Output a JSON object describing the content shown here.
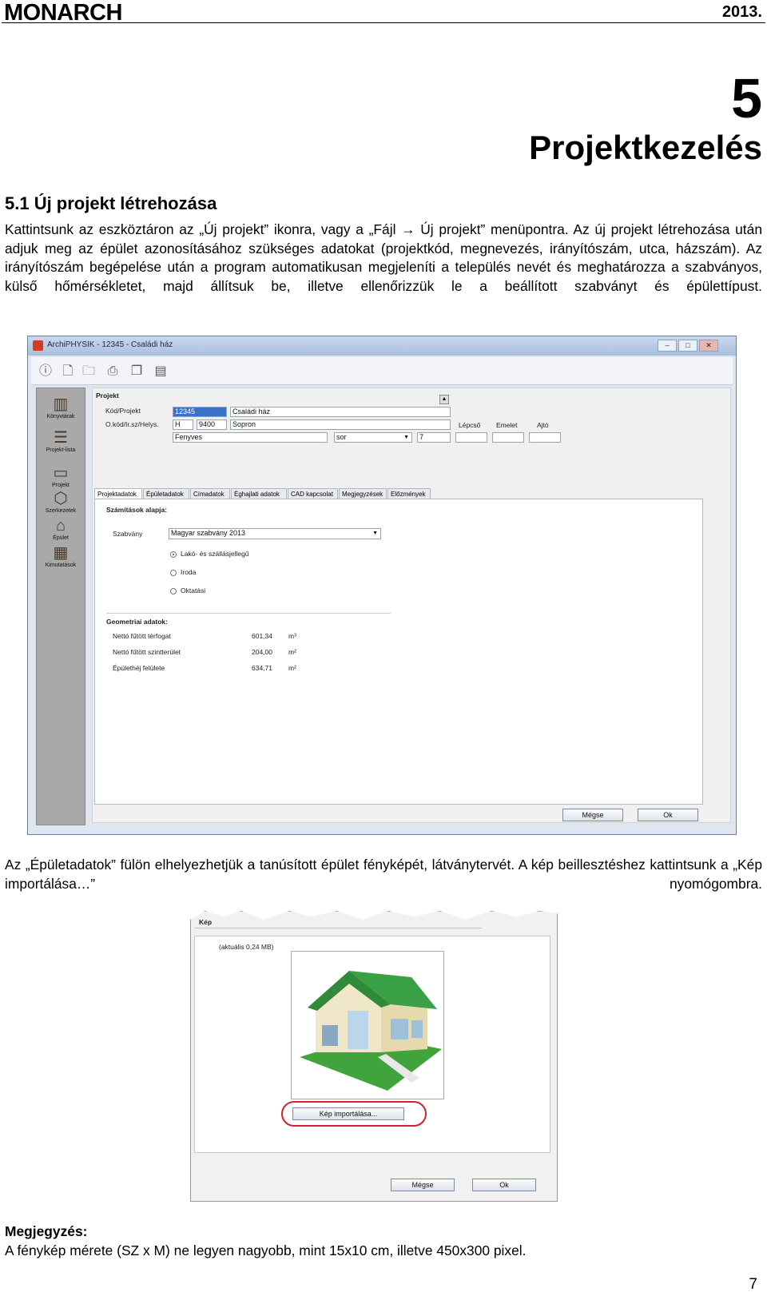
{
  "header": {
    "logo": "MONARCH",
    "year": "2013."
  },
  "chapter": {
    "number": "5",
    "title": "Projektkezelés"
  },
  "section": {
    "heading": "5.1   Új projekt létrehozása",
    "paragraph": "Kattintsunk az eszköztáron az „Új projekt” ikonra, vagy a „Fájl → Új projekt” menüpontra. Az új projekt létrehozása után adjuk meg az épület azonosításához szükséges adatokat (projektkód, megnevezés, irányítószám, utca, házszám). Az irányítószám begépelése után a program automatikusan megjeleníti a település nevét és meghatározza a szabványos, külső hőmérsékletet, majd állítsuk be, illetve ellenőrizzük le a beállított szabványt és épülettípust."
  },
  "app": {
    "window_title": "ArchiPHYSIK - 12345 - Családi ház",
    "sidebar": [
      {
        "label": "Könyvtárak",
        "icon": "books-icon"
      },
      {
        "label": "Projekt-lista",
        "icon": "list-icon"
      },
      {
        "label": "Projekt",
        "icon": "project-icon"
      },
      {
        "label": "Szerkezetek",
        "icon": "structure-icon"
      },
      {
        "label": "Épület",
        "icon": "building-icon"
      },
      {
        "label": "Kimutatások",
        "icon": "report-icon"
      }
    ],
    "project_header": "Projekt",
    "code_label": "Kód/Projekt",
    "code_value": "12345",
    "name_value": "Családi ház",
    "address_label": "O.kód/Ir.sz/Helys.",
    "country_value": "H",
    "zip_value": "9400",
    "city_value": "Sopron",
    "street_value": "Fenyves",
    "street_type_value": "sor",
    "house_number_value": "7",
    "stair_label": "Lépcső",
    "floor_label": "Emelet",
    "door_label": "Ajtó",
    "tabs": [
      "Projektadatok",
      "Épületadatok",
      "Címadatok",
      "Éghajlati adatok",
      "CAD kapcsolat",
      "Megjegyzések",
      "Előzmények"
    ],
    "calc_header": "Számítások alapja:",
    "standard_label": "Szabvány",
    "standard_value": "Magyar szabvány 2013",
    "radio_options": [
      "Lakó- és szállásjellegű",
      "Iroda",
      "Oktatási"
    ],
    "geometry_header": "Geometriai adatok:",
    "geometry_rows": [
      {
        "label": "Nettó fűtött térfogat",
        "value": "601,34",
        "unit": "m³"
      },
      {
        "label": "Nettó fűtött szintterület",
        "value": "204,00",
        "unit": "m²"
      },
      {
        "label": "Épülethéj felülete",
        "value": "634,71",
        "unit": "m²"
      }
    ],
    "cancel_label": "Mégse",
    "ok_label": "Ok"
  },
  "paragraph2": "Az „Épületadatok” fülön elhelyezhetjük a tanúsított épület fényképét, látványtervét. A kép beillesztéshez kattintsunk a „Kép importálása…” nyomógombra.",
  "dialog": {
    "group_label": "Kép",
    "size_text": "(aktuális 0,24 MB)",
    "import_label": "Kép importálása...",
    "cancel_label": "Mégse",
    "ok_label": "Ok"
  },
  "note": {
    "heading": "Megjegyzés:",
    "text": "A fénykép mérete (SZ x M) ne legyen nagyobb, mint 15x10 cm, illetve 450x300 pixel."
  },
  "page_number": "7"
}
